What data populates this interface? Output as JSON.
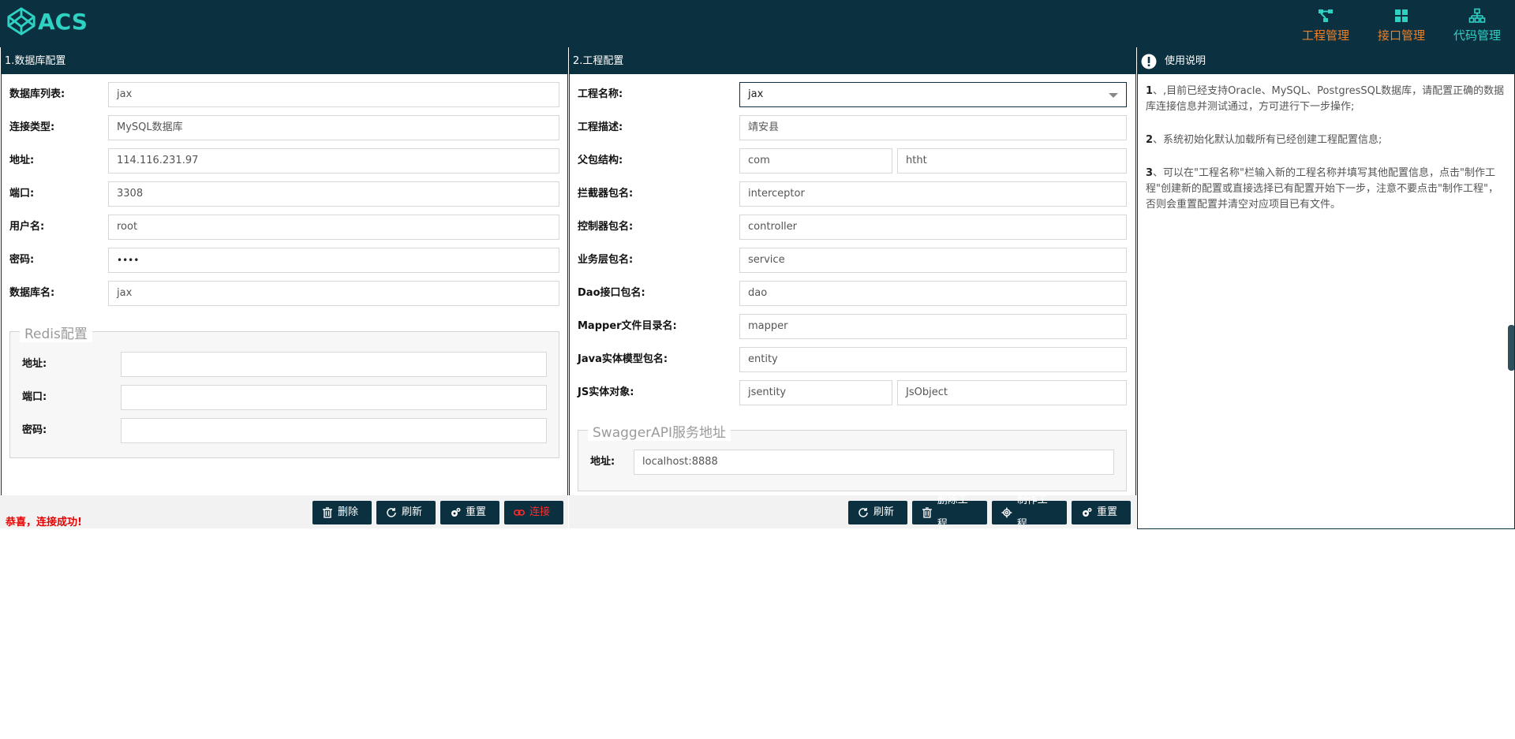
{
  "app": {
    "logo_text": "ACS",
    "brand_color": "#2fd1c3",
    "accent_color": "#f07f26",
    "header_bg": "#0b3040"
  },
  "nav": [
    {
      "label": "工程管理",
      "icon": "branch-icon"
    },
    {
      "label": "接口管理",
      "icon": "grid-icon"
    },
    {
      "label": "代码管理",
      "icon": "sitemap-icon"
    }
  ],
  "db_panel": {
    "title": "1.数据库配置",
    "fields": [
      {
        "label": "数据库列表:",
        "value": "jax"
      },
      {
        "label": "连接类型:",
        "value": "MySQL数据库"
      },
      {
        "label": "地址:",
        "value": "114.116.231.97"
      },
      {
        "label": "端口:",
        "value": "3308"
      },
      {
        "label": "用户名:",
        "value": "root"
      },
      {
        "label": "密码:",
        "value": "••••"
      },
      {
        "label": "数据库名:",
        "value": "jax"
      }
    ],
    "redis": {
      "legend": "Redis配置",
      "fields": [
        {
          "label": "地址:",
          "value": ""
        },
        {
          "label": "端口:",
          "value": ""
        },
        {
          "label": "密码:",
          "value": ""
        }
      ]
    },
    "status": "恭喜，连接成功!",
    "buttons": {
      "delete": "删除",
      "refresh": "刷新",
      "reset": "重置",
      "connect": "连接"
    }
  },
  "project_panel": {
    "title": "2.工程配置",
    "fields": {
      "name_label": "工程名称:",
      "name_value": "jax",
      "desc_label": "工程描述:",
      "desc_value": "靖安县",
      "parent_label": "父包结构:",
      "parent_value1": "com",
      "parent_value2": "htht",
      "interceptor_label": "拦截器包名:",
      "interceptor_value": "interceptor",
      "controller_label": "控制器包名:",
      "controller_value": "controller",
      "service_label": "业务层包名:",
      "service_value": "service",
      "dao_label": "Dao接口包名:",
      "dao_value": "dao",
      "mapper_label": "Mapper文件目录名:",
      "mapper_value": "mapper",
      "entity_label": "Java实体模型包名:",
      "entity_value": "entity",
      "js_label": "JS实体对象:",
      "js_value1": "jsentity",
      "js_value2": "JsObject"
    },
    "swagger": {
      "legend": "SwaggerAPI服务地址",
      "addr_label": "地址:",
      "addr_value": "localhost:8888"
    },
    "buttons": {
      "refresh": "刷新",
      "delete_project": "删除工程",
      "make_project": "制作工程",
      "reset": "重置"
    }
  },
  "help_panel": {
    "title": "使用说明",
    "items": [
      {
        "num": "1",
        "text": "、,目前已经支持Oracle、MySQL、PostgresSQL数据库，请配置正确的数据库连接信息并测试通过，方可进行下一步操作;"
      },
      {
        "num": "2",
        "text": "、系统初始化默认加载所有已经创建工程配置信息;"
      },
      {
        "num": "3",
        "text": "、可以在\"工程名称\"栏输入新的工程名称并填写其他配置信息，点击\"制作工程\"创建新的配置或直接选择已有配置开始下一步，注意不要点击\"制作工程\"，否则会重置配置并清空对应项目已有文件。"
      }
    ]
  }
}
